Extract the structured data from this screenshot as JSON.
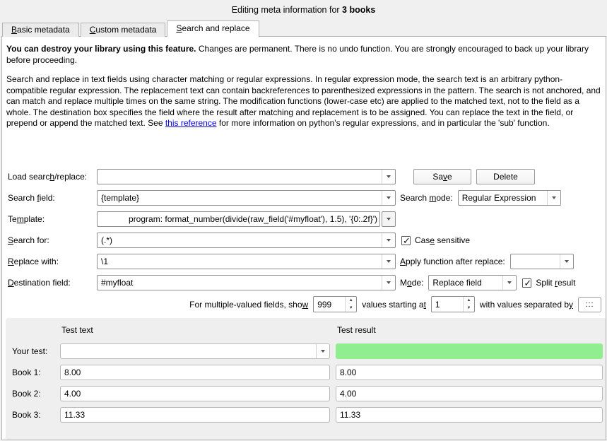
{
  "title": {
    "prefix": "Editing meta information for ",
    "bold": "3 books"
  },
  "tabs": [
    {
      "label": "&Basic metadata"
    },
    {
      "label": "&Custom metadata"
    },
    {
      "label": "&Search and replace"
    }
  ],
  "warning": {
    "bold": "You can destroy your library using this feature.",
    "rest": " Changes are permanent. There is no undo function. You are strongly encouraged to back up your library before proceeding."
  },
  "description": {
    "before_link": "Search and replace in text fields using character matching or regular expressions. In regular expression mode, the search text is an arbitrary python-compatible regular expression. The replacement text can contain backreferences to parenthesized expressions in the pattern. The search is not anchored, and can match and replace multiple times on the same string. The modification functions (lower-case etc) are applied to the matched text, not to the field as a whole. The destination box specifies the field where the result after matching and replacement is to be assigned. You can replace the text in the field, or prepend or append the matched text. See ",
    "link": "this reference",
    "after_link": " for more information on python's regular expressions, and in particular the 'sub' function."
  },
  "form": {
    "load_label": "Load searc&h/replace:",
    "load_value": "",
    "save_button": "Sa&ve",
    "delete_button": "Delete",
    "search_field_label": "Search &field:",
    "search_field_value": "{template}",
    "search_mode_label": "Search &mode:",
    "search_mode_value": "Regular Expression",
    "template_label": "Te&mplate:",
    "template_value": "program: format_number(divide(raw_field('#myfloat'), 1.5), '{0:.2f}')",
    "search_for_label": "&Search for:",
    "search_for_value": "(.*)",
    "case_sensitive_label": "Cas&e sensitive",
    "case_sensitive_checked": true,
    "replace_with_label": "&Replace with:",
    "replace_with_value": "\\1",
    "apply_function_label": "&Apply function after replace:",
    "apply_function_value": "",
    "destination_label": "&Destination field:",
    "destination_value": "#myfloat",
    "mode_label": "M&ode:",
    "mode_value": "Replace field",
    "split_result_label": "Split &result",
    "split_result_checked": true,
    "multi": {
      "text_show": "For multiple-valued fields, sho&w",
      "show_value": "999",
      "text_start": "values starting a&t",
      "start_value": "1",
      "text_sep": "with values separated b&y",
      "sep_value": ":::"
    }
  },
  "test": {
    "text_header": "Test text",
    "result_header": "Test result",
    "rows": [
      {
        "label": "Your test:",
        "text": "",
        "result": ""
      },
      {
        "label": "Book 1:",
        "text": "8.00",
        "result": "8.00"
      },
      {
        "label": "Book 2:",
        "text": "4.00",
        "result": "4.00"
      },
      {
        "label": "Book 3:",
        "text": "11.33",
        "result": "11.33"
      }
    ]
  },
  "colors": {
    "result_ok": "#90ee90",
    "link": "#0000ee"
  }
}
